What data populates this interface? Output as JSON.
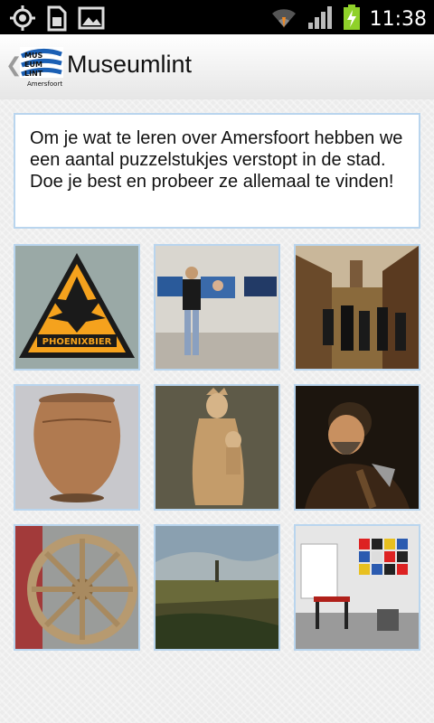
{
  "status_bar": {
    "time": "11:38",
    "icons": [
      "gps-icon",
      "sd-card-icon",
      "image-icon",
      "wifi-icon",
      "signal-icon",
      "battery-charging-icon"
    ]
  },
  "action_bar": {
    "title": "Museumlint",
    "logo_text": "Amersfoort"
  },
  "intro": {
    "text": "Om je wat te leren over Amersfoort hebben we een aantal puzzelstukjes verstopt in de stad. Doe je best en probeer ze allemaal te vinden!"
  },
  "tiles": [
    {
      "subject": "phoenix-beer-sign",
      "label": "PHOENIXBIER"
    },
    {
      "subject": "video-installation-visitor"
    },
    {
      "subject": "street-painting-procession"
    },
    {
      "subject": "clay-pot"
    },
    {
      "subject": "wooden-madonna-statue"
    },
    {
      "subject": "portrait-man-with-axe"
    },
    {
      "subject": "wooden-wagon-wheel"
    },
    {
      "subject": "landscape-painting-amersfoort"
    },
    {
      "subject": "colorful-room-interior"
    }
  ]
}
